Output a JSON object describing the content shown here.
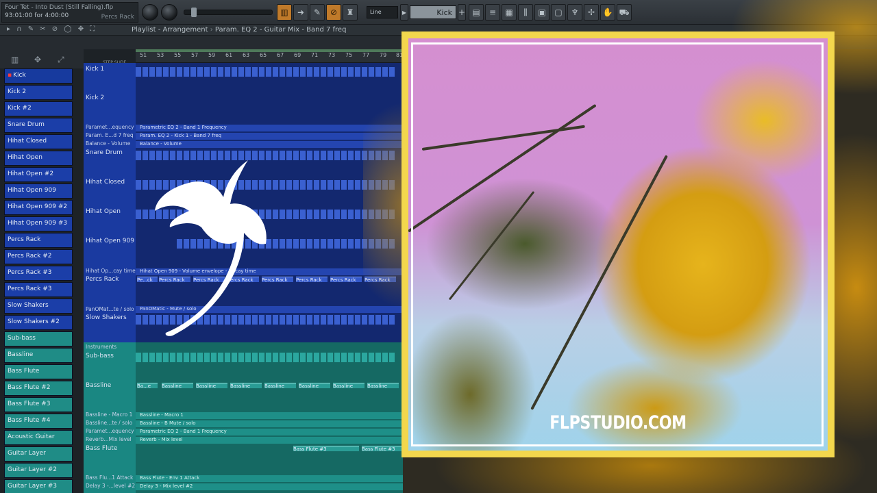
{
  "app": {
    "song_title": "Four Tet - Into Dust (Still Falling).flp",
    "song_time": "93:01:00 for 4:00:00",
    "hint_channel": "Percs Rack",
    "snap": "Line",
    "pattern": "Kick"
  },
  "playlist": {
    "tools_glyphs": "▸ ∩ ✎ ✂ ⊘ ◯ ✥ ⛶",
    "breadcrumb": [
      "Playlist - Arrangement",
      "Param. EQ 2 - Guitar Mix - Band 7 freq"
    ],
    "step_slide": "STEP  SLIDE",
    "ruler": [
      "51",
      "53",
      "55",
      "57",
      "59",
      "61",
      "63",
      "65",
      "67",
      "69",
      "71",
      "73",
      "75",
      "77",
      "79",
      "81"
    ]
  },
  "picker": {
    "drums": [
      "Kick",
      "Kick 2",
      "Kick #2",
      "Snare Drum",
      "Hihat Closed",
      "Hihat Open",
      "Hihat Open #2",
      "Hihat Open 909",
      "Hihat Open 909 #2",
      "Hihat Open 909 #3",
      "Percs Rack",
      "Percs Rack #2",
      "Percs Rack #3",
      "Percs Rack #3",
      "Slow Shakers",
      "Slow Shakers #2"
    ],
    "instruments": [
      "Sub-bass",
      "Bassline",
      "Bass Flute",
      "Bass Flute #2",
      "Bass Flute #3",
      "Bass Flute #4",
      "Acoustic Guitar",
      "Guitar Layer",
      "Guitar Layer #2",
      "Guitar Layer #3"
    ]
  },
  "tracks": {
    "kick1": "Kick 1",
    "kick2": "Kick 2",
    "param_eq_freq": "Paramet...equency",
    "param_eq_band7": "Param. E...d 7 freq",
    "balance_volume": "Balance - Volume",
    "snare": "Snare Drum",
    "hihat_closed": "Hihat Closed",
    "hihat_open": "Hihat Open",
    "hihat_open_909": "Hihat Open 909",
    "hihat_decay": "Hihat Op...cay time",
    "percs_rack": "Percs Rack",
    "panomatic": "PanOMat...te / solo",
    "slow_shakers": "Slow Shakers",
    "instruments_group": "Instruments",
    "sub_bass": "Sub-bass",
    "bassline": "Bassline",
    "bassline_macro": "Bassline - Macro 1",
    "bassline_mute": "Bassline...te / solo",
    "param_eq_freq2": "Paramet...equency",
    "reverb_mix": "Reverb...Mix level",
    "bass_flute": "Bass Flute",
    "bass_flute_attack": "Bass Flu...1 Attack",
    "delay_level": "Delay 3 -...level #2"
  },
  "clips": {
    "param_eq_band1": "Parametric EQ 2 - Band 1 Frequency",
    "param_eq_kick": "Param. EQ 2 - Kick 1 - Band 7 freq",
    "balance_volume": "Balance - Volume",
    "hihat_envelope": "Hihat Open 909 - Volume envelope - Decay time",
    "percs_first": "Pe...ck",
    "percs": "Percs Rack",
    "panomatic": "PanOMatic - Mute / solo",
    "bassline_first": "Ba...e",
    "bassline": "Bassline",
    "bassline_macro": "Bassline - Macro 1",
    "bassline_mute": "Bassline - B Mute / solo",
    "param_eq_band1_b": "Parametric EQ 2 - Band 1 Frequency",
    "reverb": "Reverb - Mix level",
    "bass_flute_3": "Bass Flute #3",
    "bass_flute_attack": "Bass Flute - Env 1 Attack",
    "delay": "Delay 3 - Mix level #2"
  },
  "overlay": {
    "site": "FLPSTUDIO.COM",
    "logo": "fl-studio-fruit-logo"
  },
  "colors": {
    "drum_track": "#1b3ea8",
    "instrument_track": "#1f8c86",
    "card_frame": "#f3d74d",
    "accent_orange": "#c07a2a"
  }
}
